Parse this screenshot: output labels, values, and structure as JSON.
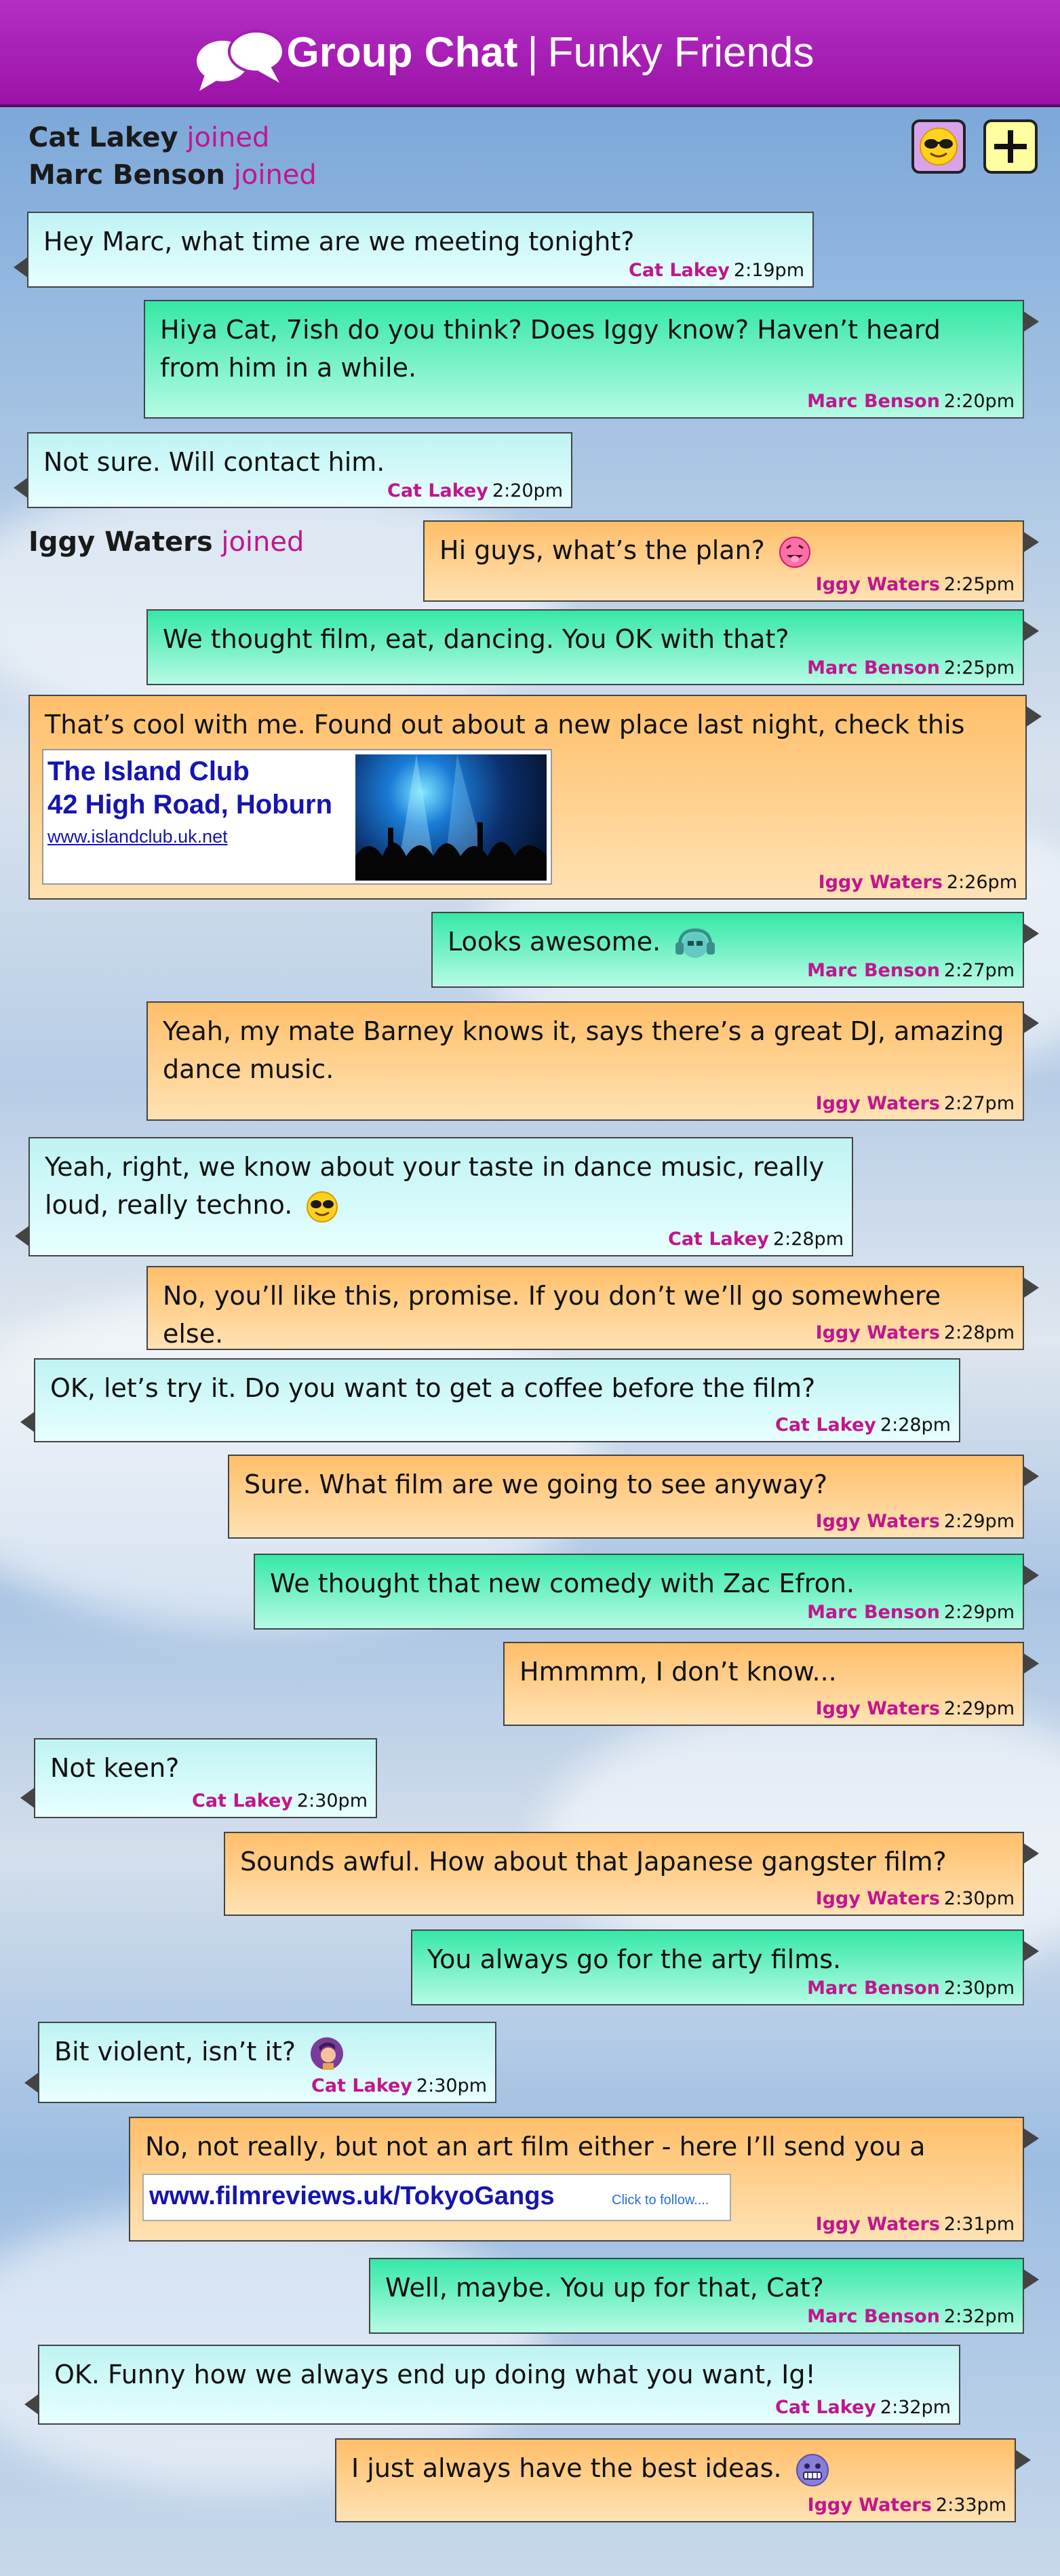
{
  "header": {
    "title_bold": "Group Chat",
    "separator": "|",
    "title_rest": "Funky Friends"
  },
  "toolbar": {
    "emoji_icon": "sunglasses-emoji-icon",
    "add_icon": "plus-icon"
  },
  "notices": [
    {
      "name": "Cat Lakey",
      "action": "joined"
    },
    {
      "name": "Marc Benson",
      "action": "joined"
    },
    {
      "name": "Iggy Waters",
      "action": "joined"
    }
  ],
  "messages": [
    {
      "sender": "Cat Lakey",
      "time": "2:19pm",
      "text": "Hey Marc, what time are we meeting tonight?"
    },
    {
      "sender": "Marc Benson",
      "time": "2:20pm",
      "text": "Hiya Cat, 7ish do you think? Does Iggy know? Haven’t heard from him in a while."
    },
    {
      "sender": "Cat Lakey",
      "time": "2:20pm",
      "text": "Not sure. Will contact him."
    },
    {
      "sender": "Iggy Waters",
      "time": "2:25pm",
      "text": "Hi guys, what’s the plan?"
    },
    {
      "sender": "Marc Benson",
      "time": "2:25pm",
      "text": "We thought film, eat, dancing. You OK with that?"
    },
    {
      "sender": "Iggy Waters",
      "time": "2:26pm",
      "text": "That’s cool with me. Found out about a new place last night, check this out."
    },
    {
      "sender": "Marc Benson",
      "time": "2:27pm",
      "text": "Looks awesome."
    },
    {
      "sender": "Iggy Waters",
      "time": "2:27pm",
      "text": "Yeah, my mate Barney knows it, says there’s a great DJ, amazing dance music."
    },
    {
      "sender": "Cat Lakey",
      "time": "2:28pm",
      "text": "Yeah, right, we know about your taste in dance music, really loud, really techno."
    },
    {
      "sender": "Iggy Waters",
      "time": "2:28pm",
      "text": "No, you’ll like this, promise. If you don’t we’ll go somewhere else."
    },
    {
      "sender": "Cat Lakey",
      "time": "2:28pm",
      "text": "OK, let’s try it. Do you want to get a coffee before the film?"
    },
    {
      "sender": "Iggy Waters",
      "time": "2:29pm",
      "text": "Sure. What film are we going to see anyway?"
    },
    {
      "sender": "Marc Benson",
      "time": "2:29pm",
      "text": "We thought that new comedy with Zac Efron."
    },
    {
      "sender": "Iggy Waters",
      "time": "2:29pm",
      "text": "Hmmmm, I don’t know..."
    },
    {
      "sender": "Cat Lakey",
      "time": "2:30pm",
      "text": "Not keen?"
    },
    {
      "sender": "Iggy Waters",
      "time": "2:30pm",
      "text": "Sounds awful. How about that Japanese gangster film?"
    },
    {
      "sender": "Marc Benson",
      "time": "2:30pm",
      "text": "You always go for the arty films."
    },
    {
      "sender": "Cat Lakey",
      "time": "2:30pm",
      "text": "Bit violent, isn’t it?"
    },
    {
      "sender": "Iggy Waters",
      "time": "2:31pm",
      "text": "No, not really, but not an art film either - here I’ll send you a review."
    },
    {
      "sender": "Marc Benson",
      "time": "2:32pm",
      "text": "Well, maybe. You up for that, Cat?"
    },
    {
      "sender": "Cat Lakey",
      "time": "2:32pm",
      "text": "OK. Funny how we always end up doing what you want, Ig!"
    },
    {
      "sender": "Iggy Waters",
      "time": "2:33pm",
      "text": "I just always have the best ideas."
    }
  ],
  "club_card": {
    "name": "The Island Club",
    "address": "42 High Road, Hoburn",
    "url": "www.islandclub.uk.net"
  },
  "review_link": {
    "url": "www.filmreviews.uk/TokyoGangs",
    "follow": "Click to follow...."
  },
  "colors": {
    "header": "#a51eb4",
    "cat_bubble": "#d6fafa",
    "marc_bubble": "#6ef0c2",
    "iggy_bubble": "#ffcf8a",
    "name_accent": "#c0168d",
    "link": "#1515b0"
  }
}
